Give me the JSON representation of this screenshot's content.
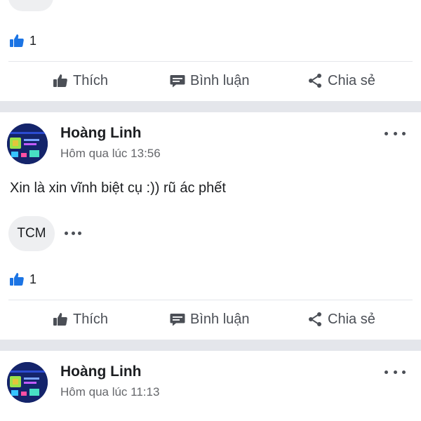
{
  "top_post": {
    "likes_count": "1",
    "actions": {
      "like": "Thích",
      "comment": "Bình luận",
      "share": "Chia sẻ"
    }
  },
  "posts": [
    {
      "author": "Hoàng Linh",
      "time": "Hôm qua lúc 13:56",
      "text": "Xin là xin vĩnh biệt cụ :)) rũ ác phết",
      "comment_chip": "TCM",
      "likes_count": "1",
      "actions": {
        "like": "Thích",
        "comment": "Bình luận",
        "share": "Chia sẻ"
      }
    },
    {
      "author": "Hoàng Linh",
      "time": "Hôm qua lúc 11:13"
    }
  ],
  "colors": {
    "like_blue": "#1b74e4",
    "separator": "#e4e6eb",
    "secondary_text": "#65676b"
  },
  "icons": [
    "like-reaction-icon",
    "thumbs-up-icon",
    "comment-icon",
    "share-icon",
    "more-icon"
  ]
}
